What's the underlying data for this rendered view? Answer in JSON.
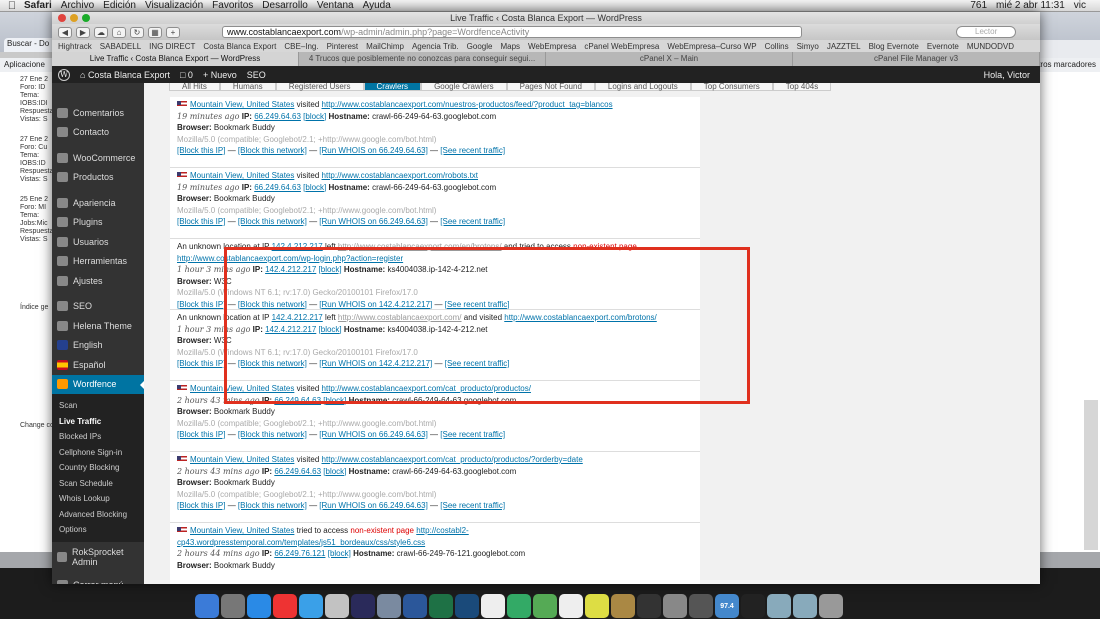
{
  "menubar": {
    "app": "Safari",
    "items": [
      "Archivo",
      "Edición",
      "Visualización",
      "Favoritos",
      "Desarrollo",
      "Ventana",
      "Ayuda"
    ],
    "status_count": "761",
    "clock": "mié 2 abr  11:31",
    "user": "vic"
  },
  "window": {
    "title": "Live Traffic ‹ Costa Blanca Export — WordPress",
    "url_host": "www.costablancaexport.com",
    "url_path": "/wp-admin/admin.php?page=WordfenceActivity",
    "search_placeholder": "Lector"
  },
  "bookmarks": [
    "Hightrack",
    "SABADELL",
    "ING DIRECT",
    "Costa Blanca Export",
    "CBE–Ing.",
    "Pinterest",
    "MailChimp",
    "Agencia Trib.",
    "Google",
    "Maps",
    "WebEmpresa",
    "cPanel WebEmpresa",
    "WebEmpresa–Curso WP",
    "Collins",
    "Simyo",
    "JAZZTEL",
    "Blog Evernote",
    "Evernote",
    "MUNDODVD"
  ],
  "tabs": [
    "Live Traffic ‹ Costa Blanca Export — WordPress",
    "4 Trucos que posiblemente no conozcas para conseguir segui...",
    "cPanel X – Main",
    "cPanel File Manager v3"
  ],
  "adminbar": {
    "site": "Costa Blanca Export",
    "comments": "0",
    "new": "Nuevo",
    "seo": "SEO",
    "howdy": "Hola, Victor"
  },
  "menu": [
    {
      "label": "Comentarios",
      "icon": "comments-icon"
    },
    {
      "label": "Contacto",
      "icon": "mail-icon"
    },
    {
      "label": "WooCommerce",
      "icon": "woocommerce-icon"
    },
    {
      "label": "Productos",
      "icon": "products-icon"
    },
    {
      "label": "Apariencia",
      "icon": "paintbrush-icon"
    },
    {
      "label": "Plugins",
      "icon": "plugin-icon"
    },
    {
      "label": "Usuarios",
      "icon": "users-icon"
    },
    {
      "label": "Herramientas",
      "icon": "tools-icon"
    },
    {
      "label": "Ajustes",
      "icon": "settings-icon"
    },
    {
      "label": "SEO",
      "icon": "seo-icon"
    },
    {
      "label": "Helena Theme",
      "icon": "theme-icon"
    },
    {
      "label": "English",
      "icon": "flag-uk-icon"
    },
    {
      "label": "Español",
      "icon": "flag-es-icon"
    },
    {
      "label": "Wordfence",
      "icon": "wordfence-icon"
    }
  ],
  "submenu": [
    "Scan",
    "Live Traffic",
    "Blocked IPs",
    "Cellphone Sign-in",
    "Country Blocking",
    "Scan Schedule",
    "Whois Lookup",
    "Advanced Blocking",
    "Options"
  ],
  "menu_tail": {
    "rok": "RokSprocket Admin",
    "collapse": "Cerrar menú"
  },
  "subtabs": [
    "All Hits",
    "Humans",
    "Registered Users",
    "Crawlers",
    "Google Crawlers",
    "Pages Not Found",
    "Logins and Logouts",
    "Top Consumers",
    "Top 404s"
  ],
  "entries": [
    {
      "loc": "Mountain View, United States",
      "verb": "visited",
      "url": "http://www.costablancaexport.com/nuestros-productos/feed/?product_tag=blancos",
      "ago": "19 minutes ago",
      "ip": "66.249.64.63",
      "host": "crawl-66-249-64-63.googlebot.com",
      "browser": "Bookmark Buddy",
      "ua": "Mozilla/5.0 (compatible; Googlebot/2.1; +http://www.google.com/bot.html)",
      "a1": "[Block this IP]",
      "a2": "[Block this network]",
      "a3": "[Run WHOIS on 66.249.64.63]",
      "a4": "[See recent traffic]"
    },
    {
      "loc": "Mountain View, United States",
      "verb": "visited",
      "url": "http://www.costablancaexport.com/robots.txt",
      "ago": "19 minutes ago",
      "ip": "66.249.64.63",
      "host": "crawl-66-249-64-63.googlebot.com",
      "browser": "Bookmark Buddy",
      "ua": "Mozilla/5.0 (compatible; Googlebot/2.1; +http://www.google.com/bot.html)",
      "a1": "[Block this IP]",
      "a2": "[Block this network]",
      "a3": "[Run WHOIS on 66.249.64.63]",
      "a4": "[See recent traffic]"
    },
    {
      "unknown": "An unknown location at IP",
      "ip": "142.4.212.217",
      "mid": "left",
      "ref": "http://www.costablancaexport.com/en/brotons/",
      "tail": "and tried to access",
      "bad": "non-existent page",
      "url": "http://www.costablancaexport.com/wp-login.php?action=register",
      "ago": "1 hour 3 mins ago",
      "host": "ks4004038.ip-142-4-212.net",
      "browser": "W3C",
      "ua": "Mozilla/5.0 (Windows NT 6.1; rv:17.0) Gecko/20100101 Firefox/17.0",
      "a1": "[Block this IP]",
      "a2": "[Block this network]",
      "a3": "[Run WHOIS on 142.4.212.217]",
      "a4": "[See recent traffic]"
    },
    {
      "unknown": "An unknown location at IP",
      "ip": "142.4.212.217",
      "mid": "left",
      "ref": "http://www.costablancaexport.com/",
      "tail": "and visited",
      "url": "http://www.costablancaexport.com/brotons/",
      "ago": "1 hour 3 mins ago",
      "host": "ks4004038.ip-142-4-212.net",
      "browser": "W3C",
      "ua": "Mozilla/5.0 (Windows NT 6.1; rv:17.0) Gecko/20100101 Firefox/17.0",
      "a1": "[Block this IP]",
      "a2": "[Block this network]",
      "a3": "[Run WHOIS on 142.4.212.217]",
      "a4": "[See recent traffic]"
    },
    {
      "loc": "Mountain View, United States",
      "verb": "visited",
      "url": "http://www.costablancaexport.com/cat_producto/productos/",
      "ago": "2 hours 43 mins ago",
      "ip": "66.249.64.63",
      "host": "crawl-66-249-64-63.googlebot.com",
      "browser": "Bookmark Buddy",
      "ua": "Mozilla/5.0 (compatible; Googlebot/2.1; +http://www.google.com/bot.html)",
      "a1": "[Block this IP]",
      "a2": "[Block this network]",
      "a3": "[Run WHOIS on 66.249.64.63]",
      "a4": "[See recent traffic]"
    },
    {
      "loc": "Mountain View, United States",
      "verb": "visited",
      "url": "http://www.costablancaexport.com/cat_producto/productos/?orderby=date",
      "ago": "2 hours 43 mins ago",
      "ip": "66.249.64.63",
      "host": "crawl-66-249-64-63.googlebot.com",
      "browser": "Bookmark Buddy",
      "ua": "Mozilla/5.0 (compatible; Googlebot/2.1; +http://www.google.com/bot.html)",
      "a1": "[Block this IP]",
      "a2": "[Block this network]",
      "a3": "[Run WHOIS on 66.249.64.63]",
      "a4": "[See recent traffic]"
    },
    {
      "loc": "Mountain View, United States",
      "verb": "tried to access",
      "bad": "non-existent page",
      "url": "http://costabl2-cp43.wordpresstemporal.com/templates/js51_bordeaux/css/style6.css",
      "ago": "2 hours 44 mins ago",
      "ip": "66.249.76.121",
      "host": "crawl-66-249-76-121.googlebot.com",
      "browser": "Bookmark Buddy"
    }
  ],
  "labels": {
    "ip": "IP:",
    "block": "[block]",
    "hostname": "Hostname:",
    "browser": "Browser:"
  },
  "colors": {
    "highlight": "#e0301e",
    "wp_blue": "#0074a2",
    "link": "#0073aa"
  },
  "bg": {
    "left_tab": "Buscar - Do",
    "apps": "Aplicacione",
    "otros": "Otros marcadores",
    "left_posts": [
      "27 Ene 2",
      "Foro: ID",
      "Tema: IOBS:IDI",
      "Respuestas:",
      "Vistas: S",
      "27 Ene 2",
      "Foro: Cu",
      "Tema: IOBS:ID",
      "Respuestas:",
      "Vistas: S",
      "25 Ene 2",
      "Foro: MI",
      "Tema: Jobs:Mic",
      "Respuestas:",
      "Vistas: S"
    ],
    "left_search": "Índice ge",
    "right": [
      "ensaje",
      "ensaje",
      "ensaje",
      "Siguiente",
      "del Sitio",
      "phpBB",
      "11:23",
      "izquie"
    ],
    "change": "Change co"
  },
  "dock": [
    {
      "n": "finder-icon",
      "c": "#3b7bd8"
    },
    {
      "n": "launchpad-icon",
      "c": "#777"
    },
    {
      "n": "appstore-icon",
      "c": "#2a8ae6"
    },
    {
      "n": "chrome-icon",
      "c": "#e33"
    },
    {
      "n": "safari-icon",
      "c": "#3aa0e8"
    },
    {
      "n": "itunes-icon",
      "c": "#c2c2c2"
    },
    {
      "n": "dashboard-icon",
      "c": "#2a2a5a"
    },
    {
      "n": "mail-app-icon",
      "c": "#7a8aa0"
    },
    {
      "n": "word-icon",
      "c": "#2b579a"
    },
    {
      "n": "excel-icon",
      "c": "#1e7145"
    },
    {
      "n": "photoshop-icon",
      "c": "#1a4a7a"
    },
    {
      "n": "calendar-icon",
      "c": "#eee"
    },
    {
      "n": "tasks-icon",
      "c": "#3a6"
    },
    {
      "n": "contacts-icon",
      "c": "#5a5"
    },
    {
      "n": "notes-icon",
      "c": "#eee"
    },
    {
      "n": "stickies-icon",
      "c": "#dd4"
    },
    {
      "n": "books-icon",
      "c": "#a84"
    },
    {
      "n": "reader-icon",
      "c": "#333"
    },
    {
      "n": "settings-app-icon",
      "c": "#888"
    },
    {
      "n": "tools-app-icon",
      "c": "#555"
    },
    {
      "n": "vm-icon",
      "c": "#48c"
    },
    {
      "n": "monitor-icon",
      "c": "#222"
    },
    {
      "n": "folder-a-icon",
      "c": "#8ab"
    },
    {
      "n": "folder-b-icon",
      "c": "#8ab"
    },
    {
      "n": "trash-icon",
      "c": "#999"
    }
  ],
  "dock_badge": "97.4"
}
